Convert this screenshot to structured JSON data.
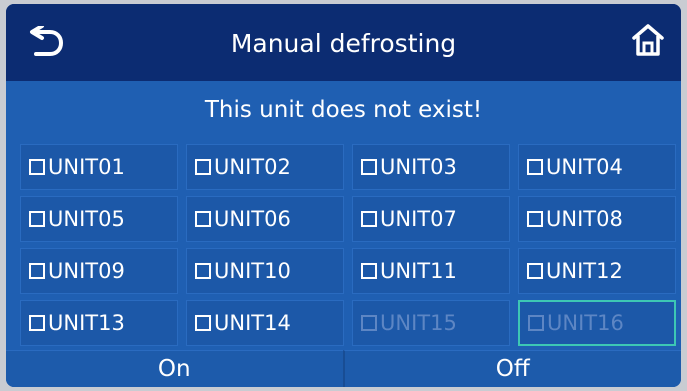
{
  "header": {
    "title": "Manual defrosting",
    "back_icon": "back-arrow-icon",
    "home_icon": "home-icon"
  },
  "message": "This unit does not exist!",
  "units": [
    {
      "label": "UNIT01",
      "enabled": true
    },
    {
      "label": "UNIT02",
      "enabled": true
    },
    {
      "label": "UNIT03",
      "enabled": true
    },
    {
      "label": "UNIT04",
      "enabled": true
    },
    {
      "label": "UNIT05",
      "enabled": true
    },
    {
      "label": "UNIT06",
      "enabled": true
    },
    {
      "label": "UNIT07",
      "enabled": true
    },
    {
      "label": "UNIT08",
      "enabled": true
    },
    {
      "label": "UNIT09",
      "enabled": true
    },
    {
      "label": "UNIT10",
      "enabled": true
    },
    {
      "label": "UNIT11",
      "enabled": true
    },
    {
      "label": "UNIT12",
      "enabled": true
    },
    {
      "label": "UNIT13",
      "enabled": true
    },
    {
      "label": "UNIT14",
      "enabled": true
    },
    {
      "label": "UNIT15",
      "enabled": false
    },
    {
      "label": "UNIT16",
      "enabled": false,
      "highlighted": true
    }
  ],
  "footer": {
    "on_label": "On",
    "off_label": "Off"
  },
  "colors": {
    "header_bg": "#0c2c72",
    "screen_bg": "#1f5fb2",
    "disabled_text": "#5d86c4",
    "highlight_border": "#3dc7b4"
  }
}
